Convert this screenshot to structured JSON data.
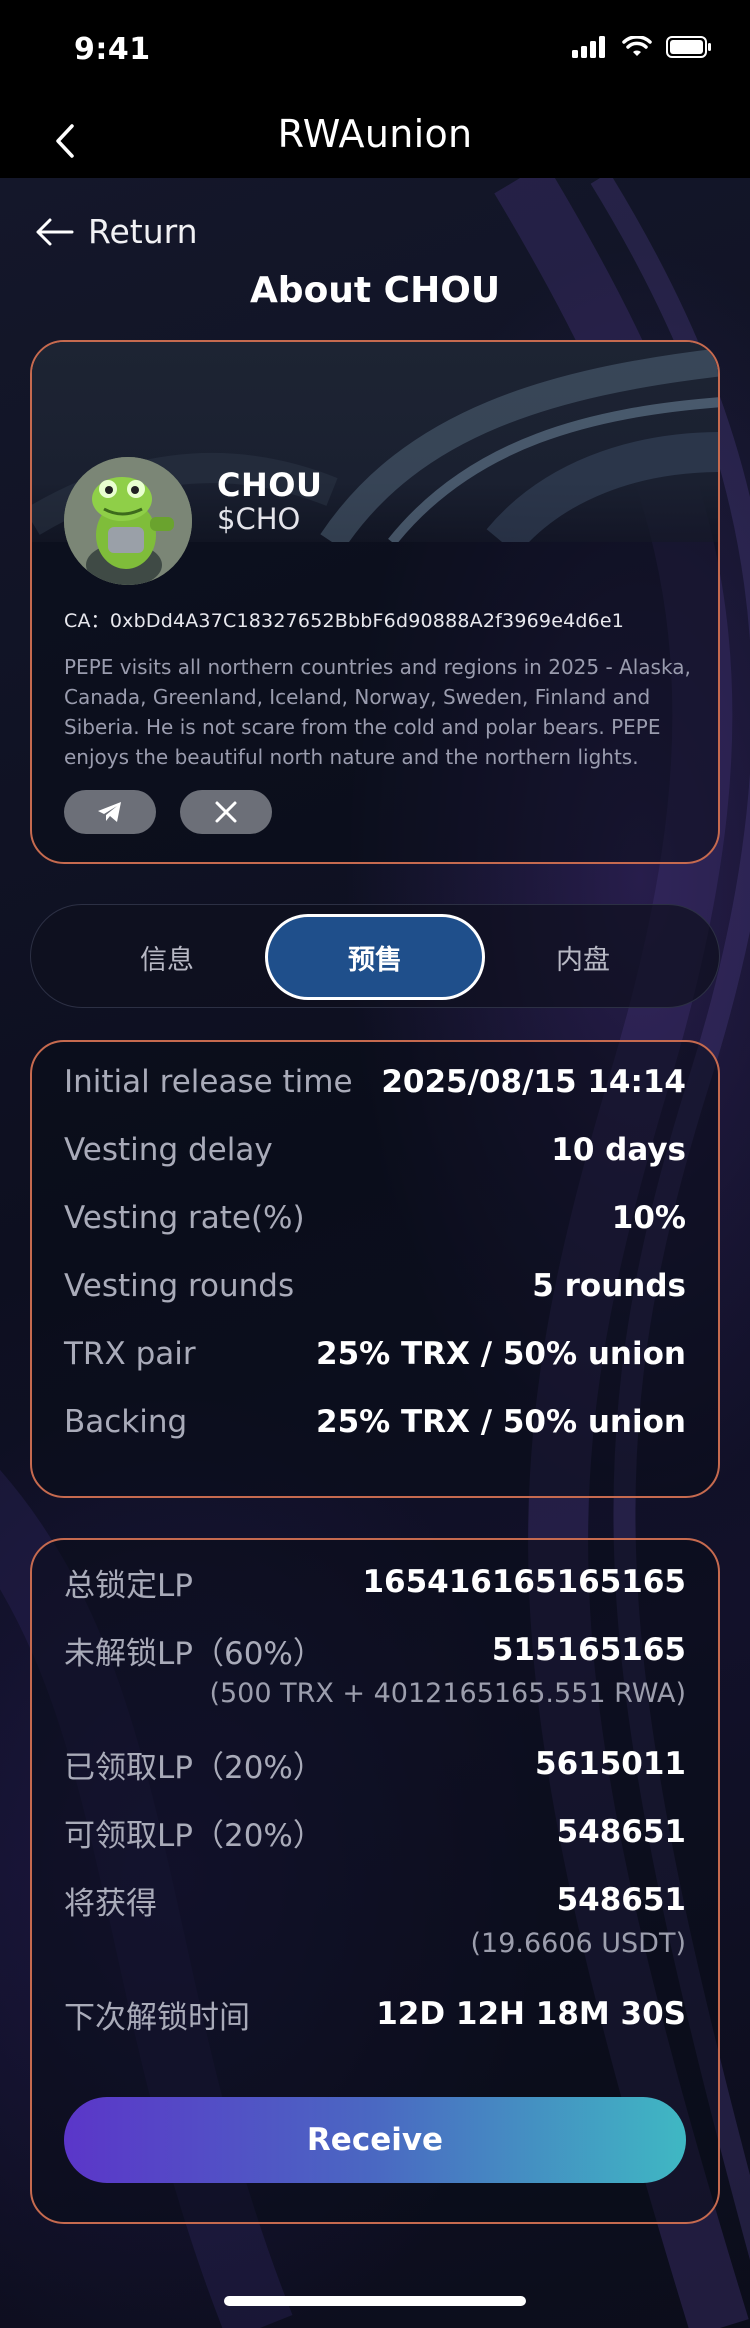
{
  "status": {
    "time": "9:41"
  },
  "nav": {
    "title": "RWAunion"
  },
  "return_label": "Return",
  "page_title": "About CHOU",
  "token": {
    "name": "CHOU",
    "symbol": "$CHO",
    "ca": "CA：0xbDd4A37C18327652BbbF6d90888A2f3969e4d6e1",
    "description": "PEPE visits all northern countries and regions in 2025 - Alaska, Canada, Greenland, Iceland, Norway, Sweden, Finland and Siberia. He is not scare from the cold and polar bears. PEPE enjoys the beautiful north nature and the northern lights.",
    "links": [
      "telegram-icon",
      "x-icon"
    ]
  },
  "tabs": [
    {
      "label": "信息",
      "active": false
    },
    {
      "label": "预售",
      "active": true
    },
    {
      "label": "内盘",
      "active": false
    }
  ],
  "vesting": [
    {
      "label": "Initial release time",
      "value": "2025/08/15 14:14"
    },
    {
      "label": "Vesting delay",
      "value": "10 days"
    },
    {
      "label": "Vesting rate(%)",
      "value": "10%"
    },
    {
      "label": "Vesting rounds",
      "value": "5 rounds"
    },
    {
      "label": "TRX pair",
      "value": "25% TRX / 50% union"
    },
    {
      "label": "Backing",
      "value": "25% TRX / 50% union"
    }
  ],
  "lp": {
    "total_label": "总锁定LP",
    "total_value": "165416165165165",
    "unlocked_label": "未解锁LP（60%）",
    "unlocked_value": "515165165",
    "unlocked_sub": "(500 TRX + 4012165165.551 RWA)",
    "claimed_label": "已领取LP（20%）",
    "claimed_value": "5615011",
    "claimable_label": "可领取LP（20%）",
    "claimable_value": "548651",
    "receive_label": "将获得",
    "receive_value": "548651",
    "receive_sub": "(19.6606 USDT)",
    "next_label": "下次解锁时间",
    "next_value": "12D 12H 18M 30S"
  },
  "receive_button": "Receive",
  "colors": {
    "accent_border": "#c66a4f",
    "tab_active": "#1f4f8b",
    "button_from": "#5b36c9",
    "button_to": "#3fb8c3"
  }
}
